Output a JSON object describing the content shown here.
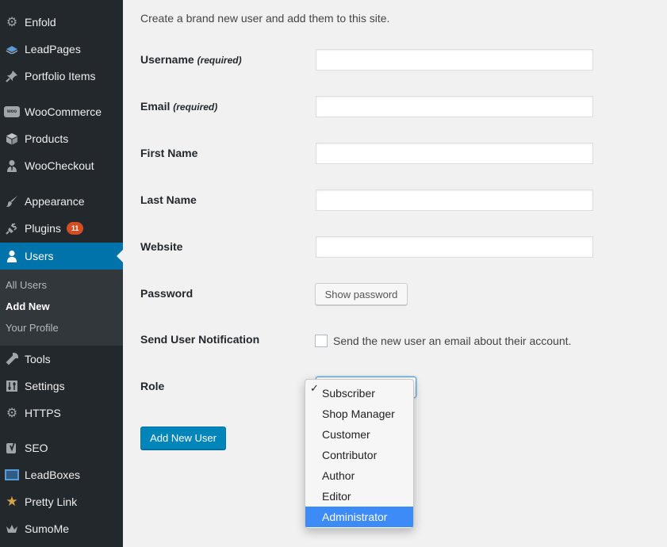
{
  "sidebar": {
    "items": [
      {
        "label": "Enfold",
        "icon": "gear-icon"
      },
      {
        "label": "LeadPages",
        "icon": "leadpages-icon"
      },
      {
        "label": "Portfolio Items",
        "icon": "pushpin-icon"
      },
      {
        "label": "WooCommerce",
        "icon": "woocommerce-icon"
      },
      {
        "label": "Products",
        "icon": "cube-icon"
      },
      {
        "label": "WooCheckout",
        "icon": "user-tie-icon"
      },
      {
        "label": "Appearance",
        "icon": "paintbrush-icon"
      },
      {
        "label": "Plugins",
        "icon": "plug-icon",
        "badge": "11"
      },
      {
        "label": "Users",
        "icon": "user-icon"
      },
      {
        "label": "Tools",
        "icon": "wrench-icon"
      },
      {
        "label": "Settings",
        "icon": "settings-sliders-icon"
      },
      {
        "label": "HTTPS",
        "icon": "gear-icon"
      },
      {
        "label": "SEO",
        "icon": "yoast-icon"
      },
      {
        "label": "LeadBoxes",
        "icon": "leadboxes-icon"
      },
      {
        "label": "Pretty Link",
        "icon": "star-icon"
      },
      {
        "label": "SumoMe",
        "icon": "crown-icon"
      }
    ],
    "submenu": {
      "all_users": "All Users",
      "add_new": "Add New",
      "your_profile": "Your Profile"
    }
  },
  "form": {
    "intro": "Create a brand new user and add them to this site.",
    "username_label": "Username",
    "email_label": "Email",
    "required_note": "(required)",
    "first_name_label": "First Name",
    "last_name_label": "Last Name",
    "website_label": "Website",
    "password_label": "Password",
    "show_password_button": "Show password",
    "notification_label": "Send User Notification",
    "notification_checkbox_text": "Send the new user an email about their account.",
    "notification_checked": false,
    "role_label": "Role",
    "submit_button": "Add New User"
  },
  "role_dropdown": {
    "selected": "Subscriber",
    "highlighted": "Administrator",
    "options": [
      "Subscriber",
      "Shop Manager",
      "Customer",
      "Contributor",
      "Author",
      "Editor",
      "Administrator"
    ],
    "check_glyph": "✓"
  },
  "colors": {
    "sidebar_bg": "#23282d",
    "current_item": "#0073aa",
    "primary_button": "#0085ba",
    "badge": "#d54e21",
    "highlight": "#3d8bf7"
  }
}
